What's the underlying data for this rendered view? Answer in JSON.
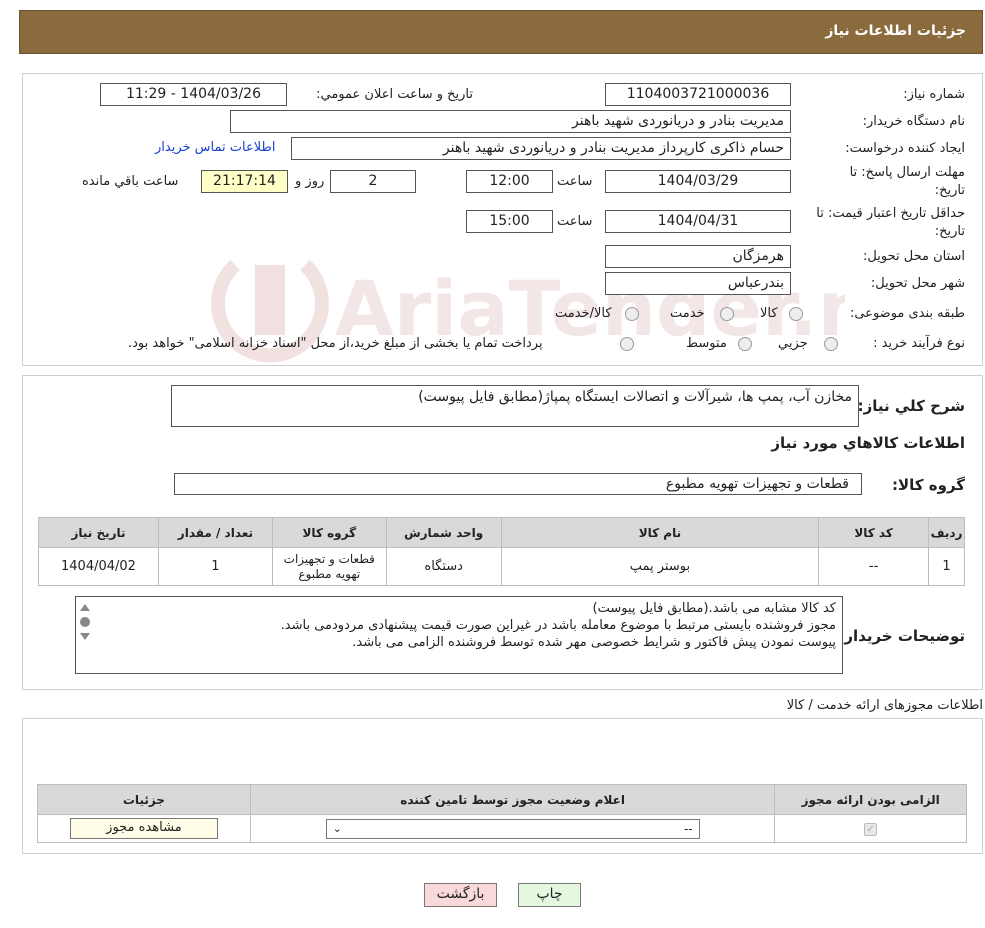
{
  "header": {
    "title": "جزئیات اطلاعات نیاز"
  },
  "form": {
    "need_number_label": "شماره نیاز:",
    "need_number": "1104003721000036",
    "announce_label": "تاریخ و ساعت اعلان عمومي:",
    "announce_value": "1404/03/26 - 11:29",
    "buyer_org_label": "نام دستگاه خریدار:",
    "buyer_org": "مدیریت بنادر و دریانوردی شهید باهنر",
    "requester_label": "ایجاد کننده درخواست:",
    "requester": "حسام  ذاکری کارپرداز مدیریت بنادر و دریانوردی شهید باهنر",
    "contact_link": "اطلاعات تماس خریدار",
    "deadline_label_1": "مهلت ارسال پاسخ: تا",
    "deadline_label_2": "تاریخ:",
    "deadline_date": "1404/03/29",
    "time_label": "ساعت",
    "deadline_time": "12:00",
    "days_value": "2",
    "days_label": "روز و",
    "remaining_time": "21:17:14",
    "remaining_label": "ساعت باقي مانده",
    "validity_label_1": "حداقل تاریخ اعتبار قیمت: تا",
    "validity_label_2": "تاریخ:",
    "validity_date": "1404/04/31",
    "validity_time": "15:00",
    "province_label": "استان محل تحویل:",
    "province": "هرمزگان",
    "city_label": "شهر محل تحویل:",
    "city": "بندرعباس",
    "category_label": "طبقه بندی موضوعی:",
    "category_options": [
      "کالا",
      "خدمت",
      "کالا/خدمت"
    ],
    "process_label": "نوع فرآیند خرید :",
    "process_options": [
      "جزیي",
      "متوسط"
    ],
    "process_note": "پرداخت تمام یا بخشی از مبلغ خرید،از محل \"اسناد خزانه اسلامی\" خواهد بود."
  },
  "summary": {
    "label": "شرح کلي نیاز:",
    "text": "مخازن آب، پمپ ها، شیرآلات و اتصالات ایستگاه پمپاژ(مطابق فایل پیوست)",
    "goods_info_title": "اطلاعات کالاهاي مورد نیاز",
    "group_label": "گروه کالا:",
    "group_value": "قطعات و تجهیزات تهویه مطبوع"
  },
  "goods_table": {
    "headers": [
      "ردیف",
      "کد کالا",
      "نام کالا",
      "واحد شمارش",
      "گروه کالا",
      "تعداد / مقدار",
      "تاریخ نیاز"
    ],
    "rows": [
      [
        "1",
        "--",
        "بوستر پمپ",
        "دستگاه",
        "قطعات و تجهیزات تهویه مطبوع",
        "1",
        "1404/04/02"
      ]
    ]
  },
  "buyer_notes": {
    "label": "توضیحات خریدار:",
    "lines": [
      "کد کالا مشابه می باشد.(مطابق فایل پیوست)",
      "مجوز فروشنده بایستی مرتبط با موضوع معامله باشد در غیراین صورت قیمت پیشنهادی مردودمی باشد.",
      "پیوست نمودن پیش فاکتور و شرایط خصوصی مهر شده توسط فروشنده الزامی می باشد."
    ]
  },
  "licenses": {
    "title": "اطلاعات مجوزهای ارائه خدمت / کالا",
    "headers": [
      "الزامی بودن ارائه مجوز",
      "اعلام وضعیت مجوز توسط تامین کننده",
      "جزئیات"
    ],
    "select_value": "--",
    "view_button": "مشاهده مجوز"
  },
  "actions": {
    "print": "چاپ",
    "back": "بازگشت"
  },
  "colors": {
    "header_bg": "#8b6a3e",
    "link": "#1a3fd1",
    "back_btn": "#f9d9d9",
    "print_btn": "#e6f7e0"
  }
}
